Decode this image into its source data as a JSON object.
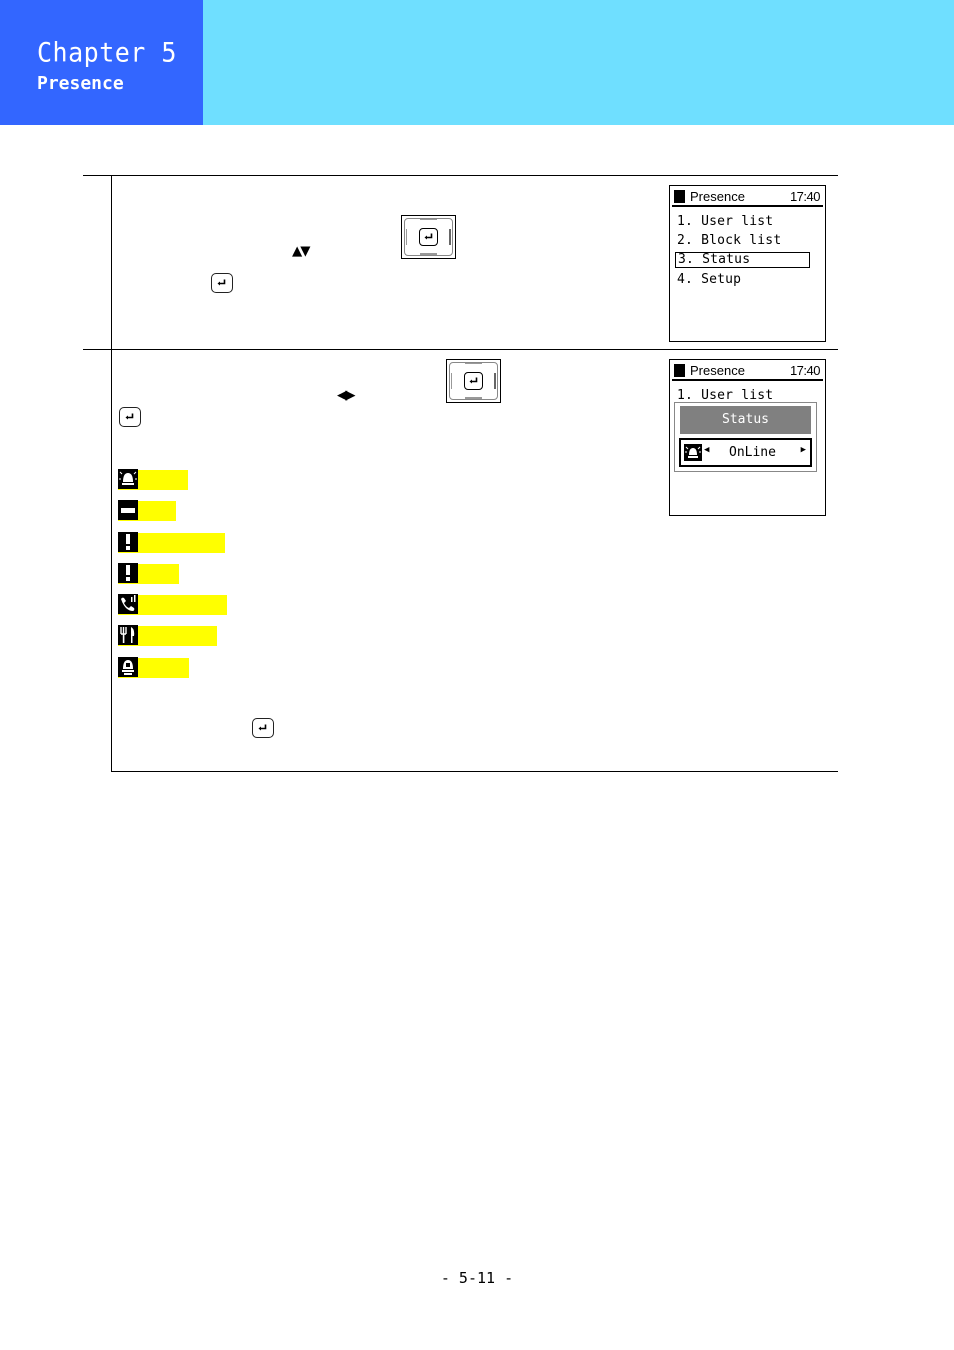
{
  "header": {
    "chapter": "Chapter 5",
    "section": "Presence",
    "colors": {
      "chapter_block": "#3366ff",
      "banner": "#6fdfff"
    }
  },
  "steps": [
    {
      "icons": [
        "up-down-arrows",
        "nav-keypad",
        "enter-key"
      ],
      "arrows": "▲▼",
      "screen": {
        "title": "Presence",
        "time": "17:40",
        "menu": [
          {
            "label": "1. User list",
            "selected": false
          },
          {
            "label": "2. Block list",
            "selected": false
          },
          {
            "label": "3. Status",
            "selected": true
          },
          {
            "label": "4. Setup",
            "selected": false
          }
        ]
      }
    },
    {
      "icons": [
        "left-right-arrows",
        "nav-keypad",
        "enter-key"
      ],
      "arrows": "◀▶",
      "screen": {
        "title": "Presence",
        "time": "17:40",
        "background_item": "1. User list",
        "popup_title": "Status",
        "selector_left": "◀",
        "selector_value": "OnLine",
        "selector_right": "▶"
      },
      "status_options": [
        {
          "icon": "online-icon"
        },
        {
          "icon": "busy-icon"
        },
        {
          "icon": "alert-icon"
        },
        {
          "icon": "alert-icon"
        },
        {
          "icon": "on-phone-icon"
        },
        {
          "icon": "out-to-lunch-icon"
        },
        {
          "icon": "offline-icon"
        }
      ],
      "highlight_color": "#ffff00"
    }
  ],
  "footer": {
    "page": "- 5-11 -"
  }
}
